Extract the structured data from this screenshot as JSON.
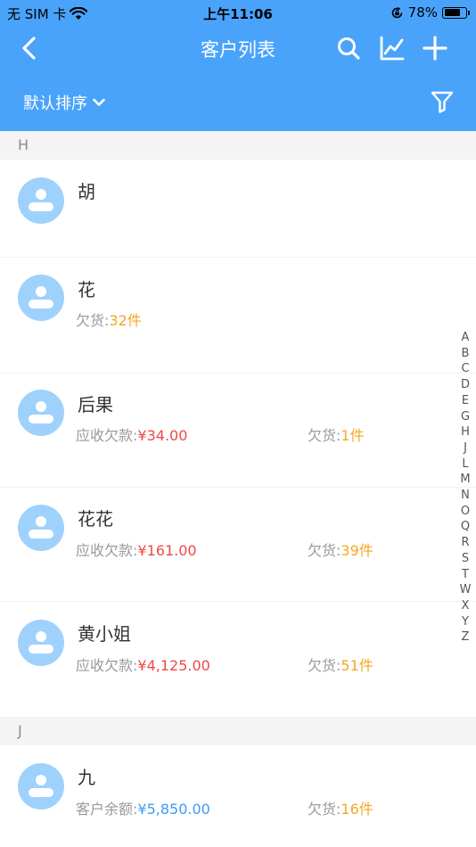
{
  "status_bar": {
    "carrier": "无 SIM 卡",
    "time": "上午11:06",
    "battery_percent": "78%",
    "battery_level": 0.78
  },
  "nav": {
    "title": "客户列表",
    "sort_label": "默认排序"
  },
  "colors": {
    "header_bg": "#4aa3fb",
    "avatar_bg": "#9fd1fd",
    "amount_red": "#f04848",
    "goods_orange": "#f5a623",
    "balance_blue": "#3d9bf5"
  },
  "sections": [
    {
      "letter": "H",
      "customers": [
        {
          "name": "胡"
        },
        {
          "name": "花",
          "goods_label": "欠货:",
          "goods_value": "32件"
        },
        {
          "name": "后果",
          "amount_label": "应收欠款:",
          "amount_value": "¥34.00",
          "goods_label": "欠货:",
          "goods_value": "1件"
        },
        {
          "name": "花花",
          "amount_label": "应收欠款:",
          "amount_value": "¥161.00",
          "goods_label": "欠货:",
          "goods_value": "39件"
        },
        {
          "name": "黄小姐",
          "amount_label": "应收欠款:",
          "amount_value": "¥4,125.00",
          "goods_label": "欠货:",
          "goods_value": "51件"
        }
      ]
    },
    {
      "letter": "J",
      "customers": [
        {
          "name": "九",
          "amount_label": "客户余额:",
          "amount_value": "¥5,850.00",
          "goods_label": "欠货:",
          "goods_value": "16件"
        }
      ]
    }
  ],
  "index_letters": [
    "A",
    "B",
    "C",
    "D",
    "E",
    "G",
    "H",
    "J",
    "L",
    "M",
    "N",
    "O",
    "Q",
    "R",
    "S",
    "T",
    "W",
    "X",
    "Y",
    "Z"
  ]
}
